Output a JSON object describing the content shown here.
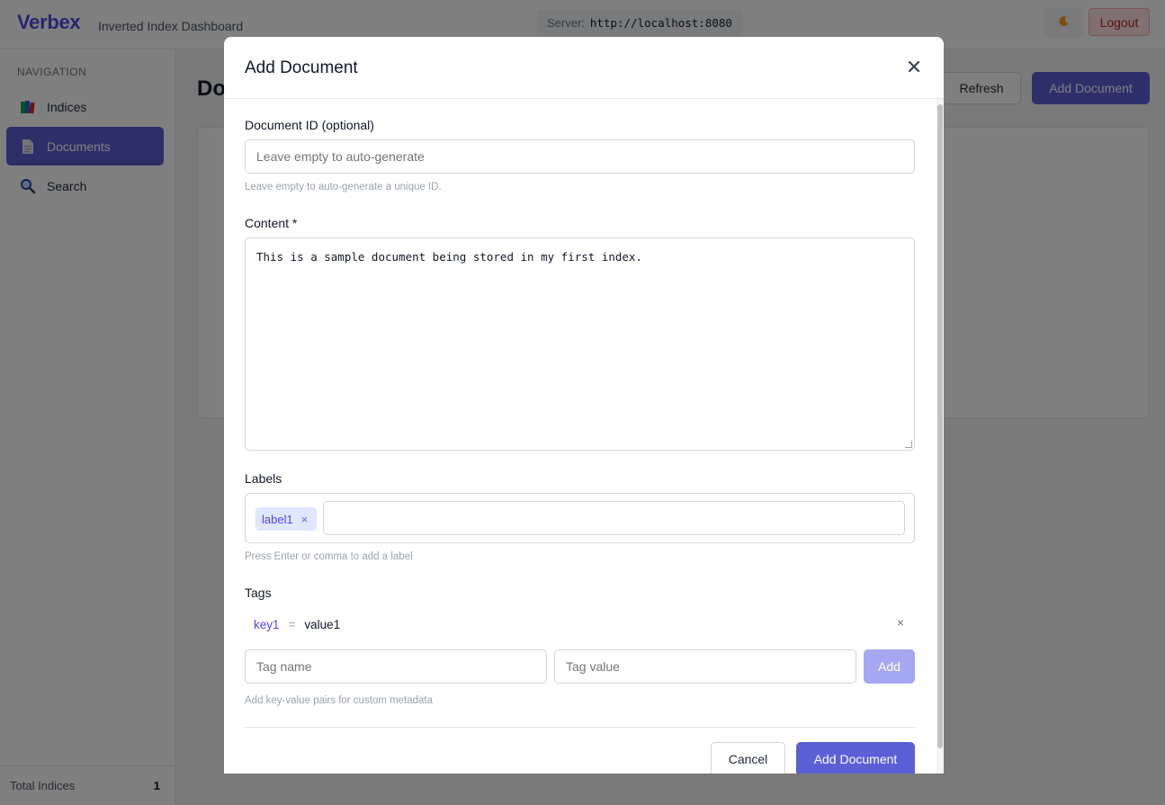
{
  "header": {
    "brand": "Verbex",
    "subtitle": "Inverted Index Dashboard",
    "server_label": "Server:",
    "server_url": "http://localhost:8080",
    "theme_icon": "moon-icon",
    "logout_label": "Logout"
  },
  "sidebar": {
    "section_title": "NAVIGATION",
    "items": [
      {
        "label": "Indices",
        "icon": "books-icon",
        "active": false
      },
      {
        "label": "Documents",
        "icon": "document-icon",
        "active": true
      },
      {
        "label": "Search",
        "icon": "magnifier-icon",
        "active": false
      }
    ],
    "footer": {
      "label": "Total Indices",
      "value": "1"
    }
  },
  "main": {
    "title": "Do",
    "refresh_label": "Refresh",
    "add_document_label": "Add Document"
  },
  "modal": {
    "title": "Add Document",
    "close_glyph": "✕",
    "document_id": {
      "label": "Document ID (optional)",
      "placeholder": "Leave empty to auto-generate",
      "value": "",
      "hint": "Leave empty to auto-generate a unique ID."
    },
    "content": {
      "label": "Content *",
      "value": "This is a sample document being stored in my first index."
    },
    "labels": {
      "label": "Labels",
      "chips": [
        "label1"
      ],
      "chip_remove": "×",
      "hint": "Press Enter or comma to add a label"
    },
    "tags": {
      "label": "Tags",
      "items": [
        {
          "key": "key1",
          "eq": "=",
          "value": "value1",
          "remove": "×"
        }
      ],
      "name_placeholder": "Tag name",
      "value_placeholder": "Tag value",
      "add_label": "Add",
      "hint": "Add key-value pairs for custom metadata"
    },
    "cancel_label": "Cancel",
    "submit_label": "Add Document"
  },
  "colors": {
    "accent": "#5b5fd6",
    "accent_disabled": "#a5a8f0",
    "chip_bg": "#e0e7ff",
    "danger": "#b91c1c"
  }
}
